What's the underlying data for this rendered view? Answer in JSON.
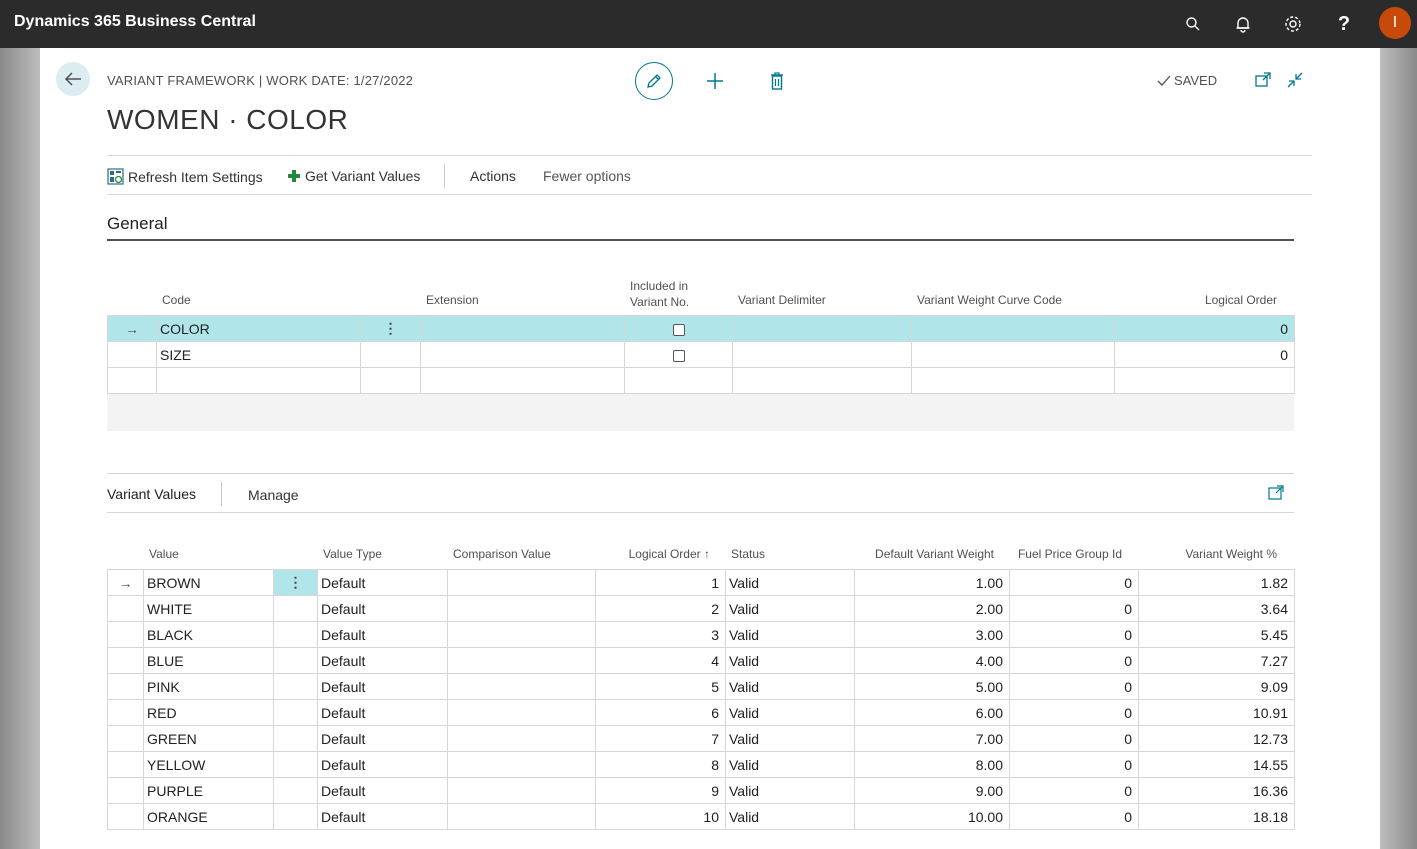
{
  "app": {
    "title": "Dynamics 365 Business Central",
    "user_initial": "I"
  },
  "topbar_icons": [
    "search-icon",
    "bell-icon",
    "gear-icon",
    "help-icon"
  ],
  "header": {
    "breadcrumb": "VARIANT FRAMEWORK | WORK DATE: 1/27/2022",
    "title": "WOMEN · COLOR",
    "saved_label": "SAVED"
  },
  "actions": {
    "refresh_item_settings": "Refresh Item Settings",
    "get_variant_values": "Get Variant Values",
    "actions": "Actions",
    "fewer_options": "Fewer options"
  },
  "general": {
    "section_title": "General",
    "columns": {
      "code": "Code",
      "extension": "Extension",
      "included_line1": "Included in",
      "included_line2": "Variant No.",
      "variant_delimiter": "Variant Delimiter",
      "weight_curve_code": "Variant Weight Curve Code",
      "logical_order": "Logical Order"
    },
    "rows": [
      {
        "code": "COLOR",
        "extension": "",
        "included": false,
        "delimiter": "",
        "curve": "",
        "logical_order": "0"
      },
      {
        "code": "SIZE",
        "extension": "",
        "included": false,
        "delimiter": "",
        "curve": "",
        "logical_order": "0"
      }
    ]
  },
  "variant_values": {
    "part_title": "Variant Values",
    "manage_label": "Manage",
    "columns": {
      "value": "Value",
      "value_type": "Value Type",
      "comparison_value": "Comparison Value",
      "logical_order": "Logical Order",
      "status": "Status",
      "default_variant_weight": "Default Variant Weight",
      "fuel_price_group_id": "Fuel Price Group Id",
      "variant_weight_pct": "Variant Weight %"
    },
    "rows": [
      {
        "value": "BROWN",
        "type": "Default",
        "comparison": "",
        "order": "1",
        "status": "Valid",
        "weight": "1.00",
        "fuel": "0",
        "pct": "1.82"
      },
      {
        "value": "WHITE",
        "type": "Default",
        "comparison": "",
        "order": "2",
        "status": "Valid",
        "weight": "2.00",
        "fuel": "0",
        "pct": "3.64"
      },
      {
        "value": "BLACK",
        "type": "Default",
        "comparison": "",
        "order": "3",
        "status": "Valid",
        "weight": "3.00",
        "fuel": "0",
        "pct": "5.45"
      },
      {
        "value": "BLUE",
        "type": "Default",
        "comparison": "",
        "order": "4",
        "status": "Valid",
        "weight": "4.00",
        "fuel": "0",
        "pct": "7.27"
      },
      {
        "value": "PINK",
        "type": "Default",
        "comparison": "",
        "order": "5",
        "status": "Valid",
        "weight": "5.00",
        "fuel": "0",
        "pct": "9.09"
      },
      {
        "value": "RED",
        "type": "Default",
        "comparison": "",
        "order": "6",
        "status": "Valid",
        "weight": "6.00",
        "fuel": "0",
        "pct": "10.91"
      },
      {
        "value": "GREEN",
        "type": "Default",
        "comparison": "",
        "order": "7",
        "status": "Valid",
        "weight": "7.00",
        "fuel": "0",
        "pct": "12.73"
      },
      {
        "value": "YELLOW",
        "type": "Default",
        "comparison": "",
        "order": "8",
        "status": "Valid",
        "weight": "8.00",
        "fuel": "0",
        "pct": "14.55"
      },
      {
        "value": "PURPLE",
        "type": "Default",
        "comparison": "",
        "order": "9",
        "status": "Valid",
        "weight": "9.00",
        "fuel": "0",
        "pct": "16.36"
      },
      {
        "value": "ORANGE",
        "type": "Default",
        "comparison": "",
        "order": "10",
        "status": "Valid",
        "weight": "10.00",
        "fuel": "0",
        "pct": "18.18"
      }
    ]
  },
  "colors": {
    "accent": "#00788f",
    "selected_row": "#b0e6ea",
    "avatar": "#c84a0a",
    "topbar": "#2b2b2b"
  }
}
